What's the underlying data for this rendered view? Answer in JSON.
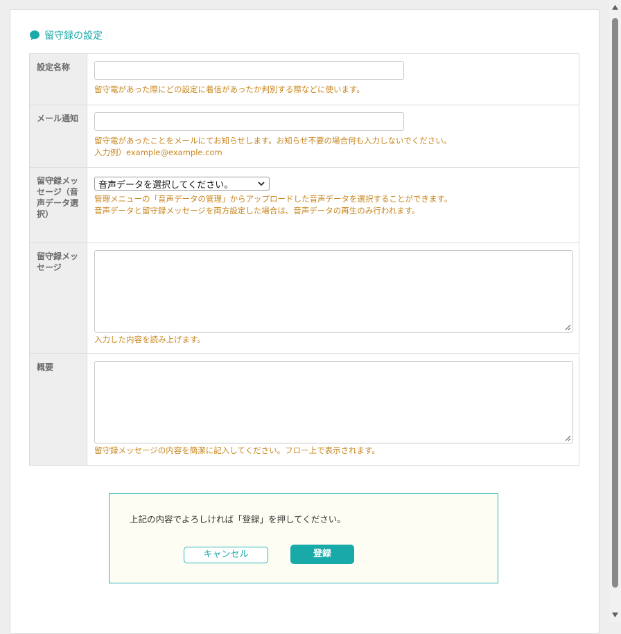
{
  "section_title": "留守録の設定",
  "fields": {
    "name": {
      "label": "設定名称",
      "value": "",
      "help": "留守電があった際にどの設定に着信があったか判別する際などに使います。"
    },
    "mail": {
      "label": "メール通知",
      "value": "",
      "help_line1": "留守電があったことをメールにてお知らせします。お知らせ不要の場合何も入力しないでください。",
      "help_line2": "入力例）example@example.com"
    },
    "voice": {
      "label": "留守録メッセージ（音声データ選択）",
      "selected": "音声データを選択してください。",
      "help_line1": "管理メニューの「音声データの管理」からアップロードした音声データを選択することができます。",
      "help_line2": "音声データと留守録メッセージを両方設定した場合は、音声データの再生のみ行われます。"
    },
    "message": {
      "label": "留守録メッセージ",
      "value": "",
      "help": "入力した内容を読み上げます。"
    },
    "summary": {
      "label": "概要",
      "value": "",
      "help": "留守録メッセージの内容を簡潔に記入してください。フロー上で表示されます。"
    }
  },
  "confirm": {
    "text": "上記の内容でよろしければ「登録」を押してください。",
    "cancel_label": "キャンセル",
    "submit_label": "登録"
  },
  "colors": {
    "accent": "#1aa8a8",
    "help_text": "#c8861e",
    "label_bg": "#eeeeee"
  },
  "icons": {
    "title": "speech-bubble-icon",
    "select": "chevron-down-icon",
    "textarea": "resize-grip-icon"
  }
}
